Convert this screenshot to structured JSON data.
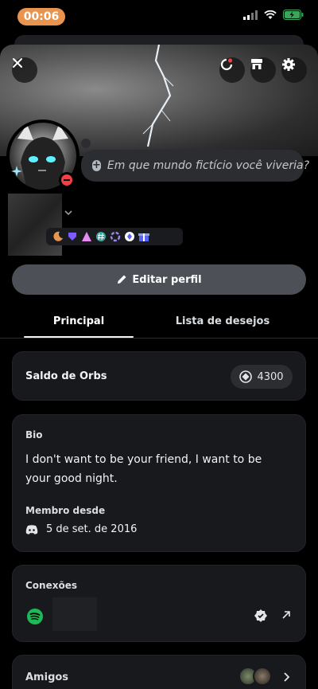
{
  "status_bar": {
    "time": "00:06"
  },
  "status": {
    "placeholder_text": "Em que mundo fictício você viveria?"
  },
  "profile": {
    "edit_label": "Editar perfil"
  },
  "tabs": [
    {
      "label": "Principal"
    },
    {
      "label": "Lista de desejos"
    }
  ],
  "orbs": {
    "label": "Saldo de Orbs",
    "value": "4300"
  },
  "bio": {
    "label": "Bio",
    "text": "I don't want to be your friend, I want to be your good night.",
    "member_since_label": "Membro desde",
    "member_since_date": "5 de set. de 2016"
  },
  "connections": {
    "label": "Conexões"
  },
  "friends": {
    "label": "Amigos"
  },
  "colors": {
    "time_pill": "#e8944f",
    "battery": "#3ba55d",
    "dnd": "#f23f43",
    "spotify": "#1db954",
    "card_bg": "#18191c",
    "button_bg": "#4e5058"
  },
  "icons": {
    "close": "close-icon",
    "nitro": "nitro-icon",
    "shop": "shop-icon",
    "settings": "gear-icon",
    "edit": "pencil-icon",
    "orb": "orb-icon",
    "discord": "discord-icon",
    "spotify": "spotify-icon",
    "verified": "verified-icon",
    "external": "external-link-icon",
    "chevron": "chevron-right-icon"
  }
}
